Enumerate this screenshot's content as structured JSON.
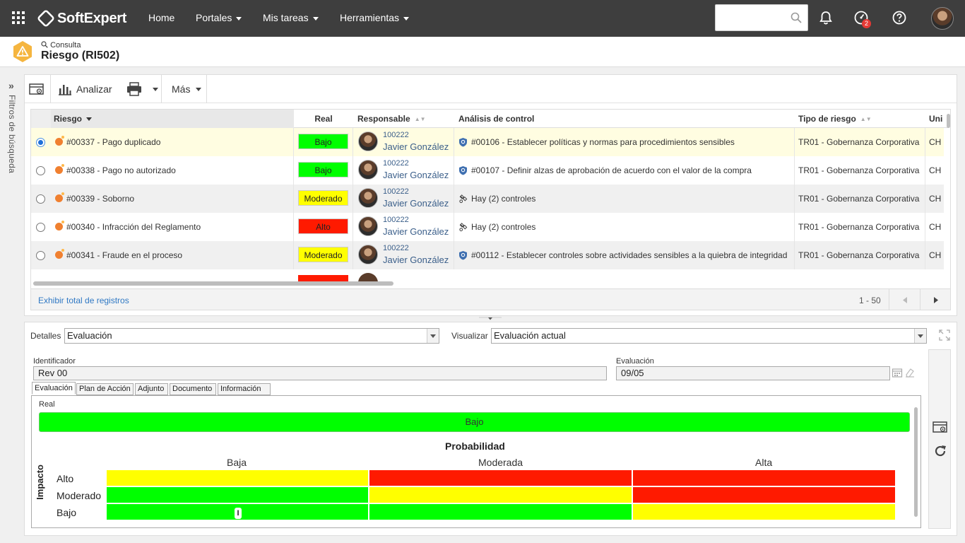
{
  "nav": {
    "brand": "SoftExpert",
    "items": [
      {
        "label": "Home",
        "dropdown": false
      },
      {
        "label": "Portales",
        "dropdown": true
      },
      {
        "label": "Mis tareas",
        "dropdown": true
      },
      {
        "label": "Herramientas",
        "dropdown": true
      }
    ],
    "search_placeholder": "",
    "badge_count": "2"
  },
  "header": {
    "crumb": "Consulta",
    "title": "Riesgo (RI502)",
    "icon": "warning-hexagon-icon"
  },
  "rail": {
    "label": "Filtros de búsqueda"
  },
  "toolbar": {
    "analyze_label": "Analizar",
    "more_label": "Más"
  },
  "grid": {
    "columns": [
      "Riesgo",
      "Real",
      "Responsable",
      "Análisis de control",
      "Tipo de riesgo",
      "Uni"
    ],
    "rows": [
      {
        "risk": "#00337 - Pago duplicado",
        "real": "Bajo",
        "real_color": "#00ff00",
        "resp_id": "100222",
        "resp_name": "Javier González",
        "control": "#00106 - Establecer políticas y normas para procedimientos sensibles",
        "control_icon": "shield",
        "type": "TR01 - Gobernanza Corporativa",
        "uni": "CH",
        "selected": true,
        "bg": "#fffde1"
      },
      {
        "risk": "#00338 - Pago no autorizado",
        "real": "Bajo",
        "real_color": "#00ff00",
        "resp_id": "100222",
        "resp_name": "Javier González",
        "control": "#00107 - Definir alzas de aprobación de acuerdo con el valor de la compra",
        "control_icon": "shield",
        "type": "TR01 - Gobernanza Corporativa",
        "uni": "CH",
        "selected": false,
        "bg": "#ffffff"
      },
      {
        "risk": "#00339 - Soborno",
        "real": "Moderado",
        "real_color": "#ffff00",
        "resp_id": "100222",
        "resp_name": "Javier González",
        "control": "Hay (2) controles",
        "control_icon": "link",
        "type": "TR01 - Gobernanza Corporativa",
        "uni": "CH",
        "selected": false,
        "bg": "#f0f0f0"
      },
      {
        "risk": "#00340 - Infracción del Reglamento",
        "real": "Alto",
        "real_color": "#ff1a00",
        "resp_id": "100222",
        "resp_name": "Javier González",
        "control": "Hay (2) controles",
        "control_icon": "link",
        "type": "TR01 - Gobernanza Corporativa",
        "uni": "CH",
        "selected": false,
        "bg": "#ffffff"
      },
      {
        "risk": "#00341 - Fraude en el proceso",
        "real": "Moderado",
        "real_color": "#ffff00",
        "resp_id": "100222",
        "resp_name": "Javier González",
        "control": "#00112 - Establecer controles sobre actividades sensibles a la quiebra de integridad",
        "control_icon": "shield",
        "type": "TR01 - Gobernanza Corporativa",
        "uni": "CH",
        "selected": false,
        "bg": "#f0f0f0"
      }
    ],
    "footer": {
      "link": "Exhibir total de registros",
      "range": "1 - 50"
    }
  },
  "details": {
    "detalles_label": "Detalles",
    "detalles_value": "Evaluación",
    "visualizar_label": "Visualizar",
    "visualizar_value": "Evaluación actual",
    "identificador_label": "Identificador",
    "identificador_value": "Rev 00",
    "evaluacion_label": "Evaluación",
    "evaluacion_value": "09/05",
    "tabs": [
      "Evaluación",
      "Plan de Acción",
      "Adjunto",
      "Documento",
      "Información"
    ],
    "real_label": "Real",
    "real_value": "Bajo",
    "matrix": {
      "prob_title": "Probabilidad",
      "impact_title": "Impacto",
      "columns": [
        "Baja",
        "Moderada",
        "Alta"
      ],
      "rows": [
        "Alto",
        "Moderado",
        "Bajo"
      ],
      "colors": [
        [
          "#ffff00",
          "#ff1a00",
          "#ff1a00"
        ],
        [
          "#00ff00",
          "#ffff00",
          "#ff1a00"
        ],
        [
          "#00ff00",
          "#00ff00",
          "#ffff00"
        ]
      ],
      "marker_text": "I"
    }
  }
}
